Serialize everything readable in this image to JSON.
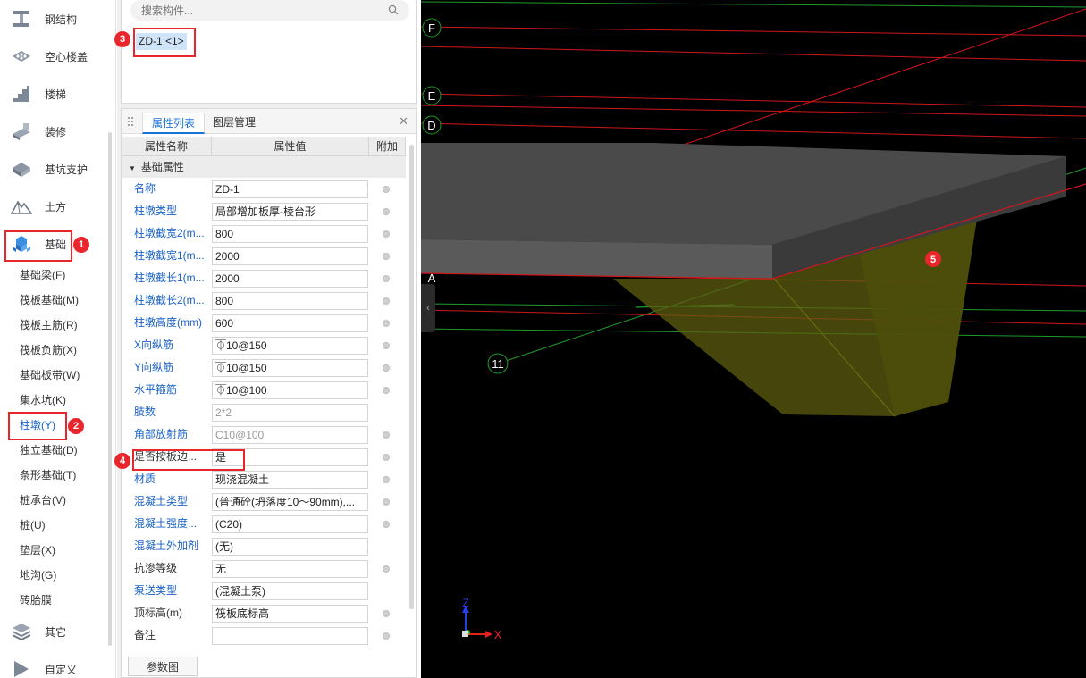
{
  "nav": {
    "categories": [
      {
        "label": "钢结构",
        "icon": "steel-structure-icon"
      },
      {
        "label": "空心楼盖",
        "icon": "hollow-floor-icon"
      },
      {
        "label": "楼梯",
        "icon": "stairs-icon"
      },
      {
        "label": "装修",
        "icon": "decoration-icon"
      },
      {
        "label": "基坑支护",
        "icon": "pit-support-icon"
      },
      {
        "label": "土方",
        "icon": "earthwork-icon"
      },
      {
        "label": "基础",
        "icon": "foundation-icon"
      }
    ],
    "sub_items": [
      "基础梁(F)",
      "筏板基础(M)",
      "筏板主筋(R)",
      "筏板负筋(X)",
      "基础板带(W)",
      "集水坑(K)",
      "柱墩(Y)",
      "独立基础(D)",
      "条形基础(T)",
      "桩承台(V)",
      "桩(U)",
      "垫层(X)",
      "地沟(G)",
      "砖胎膜"
    ],
    "bottom_categories": [
      {
        "label": "其它",
        "icon": "other-icon"
      },
      {
        "label": "自定义",
        "icon": "custom-icon"
      }
    ]
  },
  "component_list": {
    "search_placeholder": "搜索构件...",
    "items": [
      "ZD-1 <1>"
    ]
  },
  "properties": {
    "tabs": [
      "属性列表",
      "图层管理"
    ],
    "columns": [
      "属性名称",
      "属性值",
      "附加"
    ],
    "group": "基础属性",
    "rows": [
      {
        "name": "名称",
        "value": "ZD-1",
        "blue": true,
        "dot": true,
        "gray": false
      },
      {
        "name": "柱墩类型",
        "value": "局部增加板厚-棱台形",
        "blue": true,
        "dot": true,
        "gray": false
      },
      {
        "name": "柱墩截宽2(m...",
        "value": "800",
        "blue": true,
        "dot": true,
        "gray": false
      },
      {
        "name": "柱墩截宽1(m...",
        "value": "2000",
        "blue": true,
        "dot": true,
        "gray": false
      },
      {
        "name": "柱墩截长1(m...",
        "value": "2000",
        "blue": true,
        "dot": true,
        "gray": false
      },
      {
        "name": "柱墩截长2(m...",
        "value": "800",
        "blue": true,
        "dot": true,
        "gray": false
      },
      {
        "name": "柱墩高度(mm)",
        "value": "600",
        "blue": true,
        "dot": true,
        "gray": false
      },
      {
        "name": "X向纵筋",
        "value": "⏁10@150",
        "blue": true,
        "dot": true,
        "gray": false
      },
      {
        "name": "Y向纵筋",
        "value": "⏁10@150",
        "blue": true,
        "dot": true,
        "gray": false
      },
      {
        "name": "水平箍筋",
        "value": "⏁10@100",
        "blue": true,
        "dot": true,
        "gray": false
      },
      {
        "name": "肢数",
        "value": "2*2",
        "blue": true,
        "dot": false,
        "gray": true
      },
      {
        "name": "角部放射筋",
        "value": "C10@100",
        "blue": true,
        "dot": true,
        "gray": true
      },
      {
        "name": "是否按板边...",
        "value": "是",
        "blue": false,
        "dot": true,
        "gray": false
      },
      {
        "name": "材质",
        "value": "现浇混凝土",
        "blue": true,
        "dot": true,
        "gray": false
      },
      {
        "name": "混凝土类型",
        "value": "(普通砼(坍落度10～90mm),...",
        "blue": true,
        "dot": true,
        "gray": false
      },
      {
        "name": "混凝土强度...",
        "value": "(C20)",
        "blue": true,
        "dot": true,
        "gray": false
      },
      {
        "name": "混凝土外加剂",
        "value": "(无)",
        "blue": true,
        "dot": false,
        "gray": false
      },
      {
        "name": "抗渗等级",
        "value": "无",
        "blue": false,
        "dot": true,
        "gray": false
      },
      {
        "name": "泵送类型",
        "value": "(混凝土泵)",
        "blue": true,
        "dot": false,
        "gray": false
      },
      {
        "name": "顶标高(m)",
        "value": "筏板底标高",
        "blue": false,
        "dot": true,
        "gray": false
      },
      {
        "name": "备注",
        "value": "",
        "blue": false,
        "dot": true,
        "gray": false
      }
    ],
    "param_button": "参数图"
  },
  "viewport": {
    "axis_labels": [
      "F",
      "E",
      "D",
      "A",
      "11"
    ],
    "axes": {
      "z": "Z",
      "x": "X"
    }
  },
  "annotations": [
    "1",
    "2",
    "3",
    "4",
    "5"
  ],
  "colors": {
    "accent": "#1a73d9",
    "highlight": "#e8272c",
    "grid_green": "#1f9a2a",
    "grid_red": "#d0151c",
    "slab": "#4a4a4a",
    "pier": "#6b6b10"
  }
}
